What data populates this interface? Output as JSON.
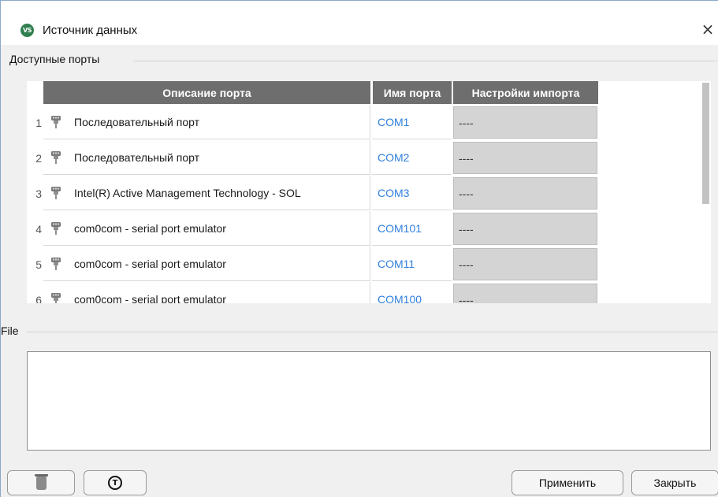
{
  "window": {
    "title": "Источник данных",
    "app_logo_text": "VS",
    "close_glyph": "×"
  },
  "ports_group": {
    "label": "Доступные порты",
    "columns": {
      "description": "Описание порта",
      "name": "Имя порта",
      "import": "Настройки импорта"
    },
    "rows": [
      {
        "num": "1",
        "description": "Последовательный порт",
        "name": "COM1",
        "import": "----"
      },
      {
        "num": "2",
        "description": "Последовательный порт",
        "name": "COM2",
        "import": "----"
      },
      {
        "num": "3",
        "description": "Intel(R) Active Management Technology - SOL",
        "name": "COM3",
        "import": "----"
      },
      {
        "num": "4",
        "description": "com0com - serial port emulator",
        "name": "COM101",
        "import": "----"
      },
      {
        "num": "5",
        "description": "com0com - serial port emulator",
        "name": "COM11",
        "import": "----"
      },
      {
        "num": "6",
        "description": "com0com - serial port emulator",
        "name": "COM100",
        "import": "----"
      }
    ]
  },
  "file_group": {
    "label": "File",
    "value": ""
  },
  "footer": {
    "info_glyph": "T",
    "apply_label": "Применить",
    "close_label": "Закрыть"
  },
  "colors": {
    "header_bg": "#6e6e6e",
    "port_name": "#2f7fdc",
    "import_cell": "#d4d4d4"
  }
}
